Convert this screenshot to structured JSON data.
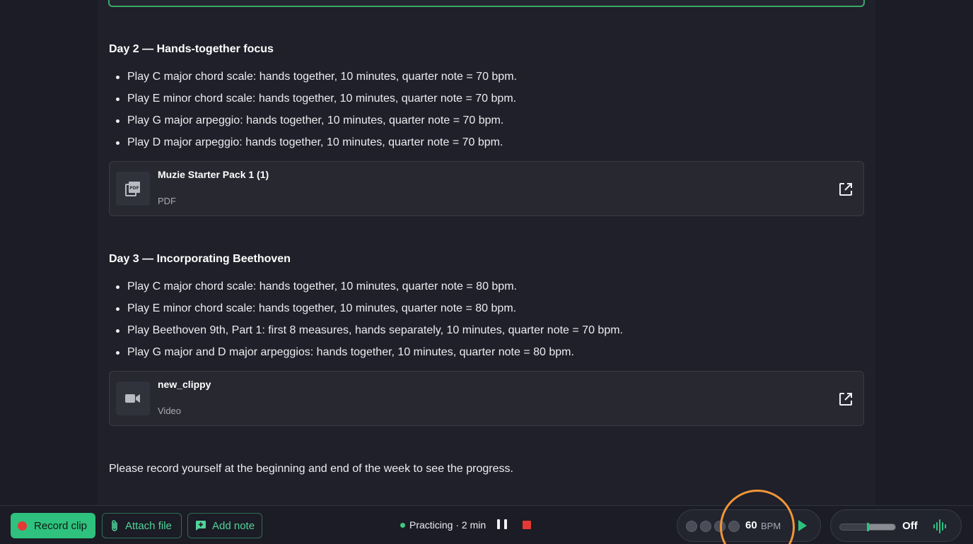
{
  "lesson": {
    "day2": {
      "heading": "Day 2 — Hands-together focus",
      "tasks": [
        "Play C major chord scale: hands together, 10 minutes, quarter note = 70 bpm.",
        "Play E minor chord scale: hands together, 10 minutes, quarter note = 70 bpm.",
        "Play G major arpeggio: hands together, 10 minutes, quarter note = 70 bpm.",
        "Play D major arpeggio: hands together, 10 minutes, quarter note = 70 bpm."
      ],
      "attachment": {
        "name": "Muzie Starter Pack 1 (1)",
        "type": "PDF",
        "icon": "pdf-icon"
      }
    },
    "day3": {
      "heading": "Day 3 — Incorporating Beethoven",
      "tasks": [
        "Play C major chord scale: hands together, 10 minutes, quarter note = 80 bpm.",
        "Play E minor chord scale: hands together, 10 minutes, quarter note = 80 bpm.",
        "Play Beethoven 9th, Part 1: first 8 measures, hands separately, 10 minutes, quarter note = 70 bpm.",
        "Play G major and D major arpeggios: hands together, 10 minutes, quarter note = 80 bpm."
      ],
      "attachment": {
        "name": "new_clippy",
        "type": "Video",
        "icon": "video-camera-icon"
      }
    },
    "closing": "Please record yourself at the beginning and end of the week to see the progress."
  },
  "toolbar": {
    "record_label": "Record clip",
    "attach_label": "Attach file",
    "note_label": "Add note",
    "status_text": "Practicing · 2 min",
    "metronome": {
      "bpm": "60",
      "unit": "BPM",
      "beats": 4
    },
    "drone": {
      "label": "Off"
    }
  },
  "colors": {
    "accent": "#2ec27e",
    "record_dot": "#e53935",
    "highlight": "#f29537",
    "background": "#1b1c26"
  }
}
